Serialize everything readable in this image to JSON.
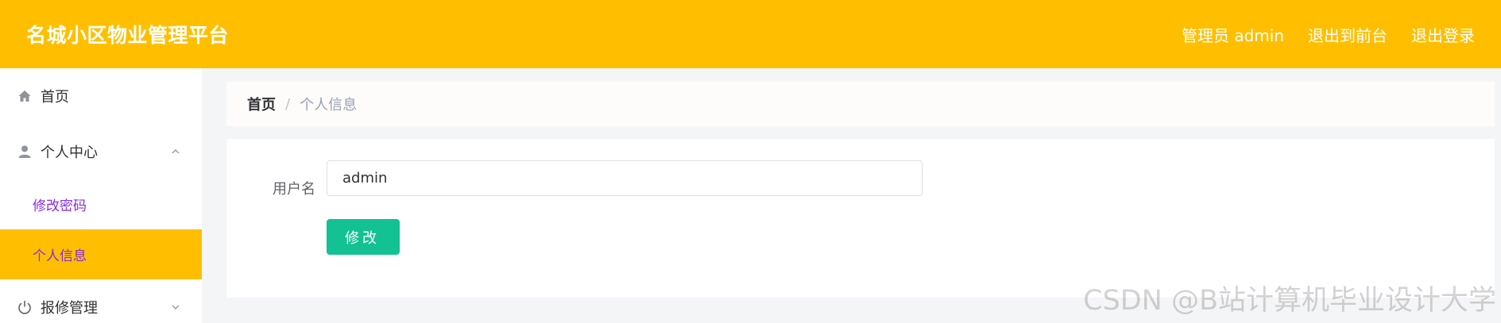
{
  "header": {
    "brand": "名城小区物业管理平台",
    "admin_label": "管理员 admin",
    "exit_frontend": "退出到前台",
    "logout": "退出登录"
  },
  "sidebar": {
    "items": [
      {
        "label": "首页",
        "icon": "home-icon"
      },
      {
        "label": "个人中心",
        "icon": "user-icon",
        "expanded": true,
        "children": [
          {
            "label": "修改密码",
            "active": false
          },
          {
            "label": "个人信息",
            "active": true
          }
        ]
      },
      {
        "label": "报修管理",
        "icon": "power-icon",
        "expanded": false
      }
    ]
  },
  "breadcrumb": {
    "home": "首页",
    "separator": "/",
    "current": "个人信息"
  },
  "form": {
    "username_label": "用户名",
    "username_value": "admin",
    "submit_label": "修改"
  },
  "watermark": "CSDN @B站计算机毕业设计大学",
  "colors": {
    "header_bg": "#FFBF00",
    "active_menu_bg": "#FFBF00",
    "submenu_text": "#8A2BE2",
    "button_bg": "#12C293"
  }
}
